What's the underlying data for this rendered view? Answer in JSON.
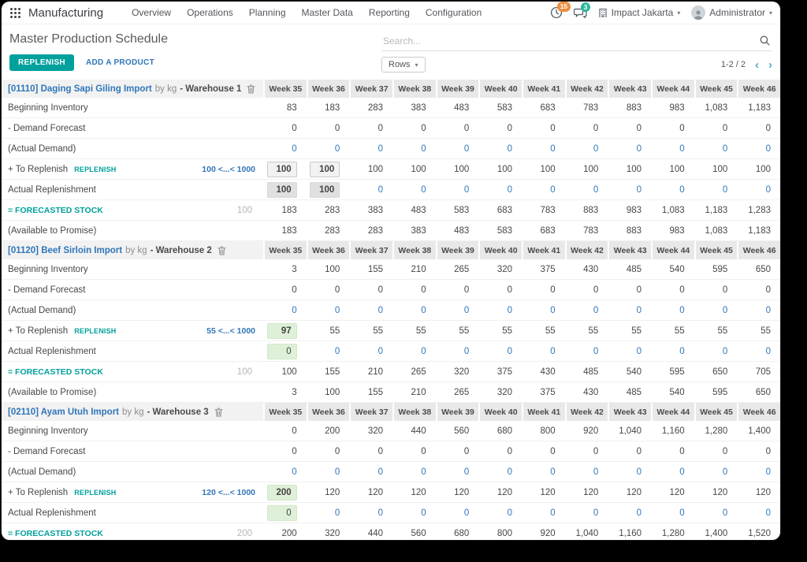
{
  "colors": {
    "accent": "#00a09d",
    "link": "#3076b9",
    "badge_activity": "#ee8e3f",
    "badge_message": "#2fb79e"
  },
  "navbar": {
    "app_name": "Manufacturing",
    "menus": [
      "Overview",
      "Operations",
      "Planning",
      "Master Data",
      "Reporting",
      "Configuration"
    ],
    "activity_badge": "15",
    "message_badge": "3",
    "company": "Impact Jakarta",
    "user": "Administrator"
  },
  "control_panel": {
    "title": "Master Production Schedule",
    "replenish_button": "REPLENISH",
    "add_product_link": "ADD A PRODUCT",
    "search_placeholder": "Search...",
    "rows_button": "Rows",
    "pager": "1-2 / 2"
  },
  "weeks": [
    "Week 35",
    "Week 36",
    "Week 37",
    "Week 38",
    "Week 39",
    "Week 40",
    "Week 41",
    "Week 42",
    "Week 43",
    "Week 44",
    "Week 45",
    "Week 46"
  ],
  "products": [
    {
      "title": "[01110] Daging Sapi Giling Import",
      "unit": "by kg",
      "warehouse": "- Warehouse 1",
      "rows": [
        {
          "key": "beginning",
          "label": "Beginning Inventory",
          "default": "num",
          "values": [
            "83",
            "183",
            "283",
            "383",
            "483",
            "583",
            "683",
            "783",
            "883",
            "983",
            "1,083",
            "1,183"
          ]
        },
        {
          "key": "demand_forecast",
          "label": "- Demand Forecast",
          "default": "num",
          "values": [
            "0",
            "0",
            "0",
            "0",
            "0",
            "0",
            "0",
            "0",
            "0",
            "0",
            "0",
            "0"
          ]
        },
        {
          "key": "actual_demand",
          "label": "(Actual Demand)",
          "default": "link",
          "values": [
            "0",
            "0",
            "0",
            "0",
            "0",
            "0",
            "0",
            "0",
            "0",
            "0",
            "0",
            "0"
          ]
        },
        {
          "key": "to_replenish",
          "label": "+ To Replenish",
          "link": "REPLENISH",
          "range": "100 <...< 1000",
          "default": "num",
          "special": {
            "0": "gray-input",
            "1": "gray-input"
          },
          "values": [
            "100",
            "100",
            "100",
            "100",
            "100",
            "100",
            "100",
            "100",
            "100",
            "100",
            "100",
            "100"
          ]
        },
        {
          "key": "actual_replenishment",
          "label": "Actual Replenishment",
          "default": "link",
          "special": {
            "0": "gray-fill",
            "1": "gray-fill"
          },
          "values": [
            "100",
            "100",
            "0",
            "0",
            "0",
            "0",
            "0",
            "0",
            "0",
            "0",
            "0",
            "0"
          ]
        },
        {
          "key": "forecasted",
          "label": "= FORECASTED STOCK",
          "indicator": "100",
          "default": "num",
          "values": [
            "183",
            "283",
            "383",
            "483",
            "583",
            "683",
            "783",
            "883",
            "983",
            "1,083",
            "1,183",
            "1,283"
          ]
        },
        {
          "key": "atp",
          "label": "(Available to Promise)",
          "default": "num",
          "values": [
            "183",
            "283",
            "283",
            "383",
            "483",
            "583",
            "683",
            "783",
            "883",
            "983",
            "1,083",
            "1,183"
          ]
        }
      ]
    },
    {
      "title": "[01120] Beef Sirloin Import",
      "unit": "by kg",
      "warehouse": "- Warehouse 2",
      "rows": [
        {
          "key": "beginning",
          "label": "Beginning Inventory",
          "default": "num",
          "values": [
            "3",
            "100",
            "155",
            "210",
            "265",
            "320",
            "375",
            "430",
            "485",
            "540",
            "595",
            "650"
          ]
        },
        {
          "key": "demand_forecast",
          "label": "- Demand Forecast",
          "default": "num",
          "values": [
            "0",
            "0",
            "0",
            "0",
            "0",
            "0",
            "0",
            "0",
            "0",
            "0",
            "0",
            "0"
          ]
        },
        {
          "key": "actual_demand",
          "label": "(Actual Demand)",
          "default": "link",
          "values": [
            "0",
            "0",
            "0",
            "0",
            "0",
            "0",
            "0",
            "0",
            "0",
            "0",
            "0",
            "0"
          ]
        },
        {
          "key": "to_replenish",
          "label": "+ To Replenish",
          "link": "REPLENISH",
          "range": "55 <...< 1000",
          "default": "num",
          "special": {
            "0": "green-input"
          },
          "values": [
            "97",
            "55",
            "55",
            "55",
            "55",
            "55",
            "55",
            "55",
            "55",
            "55",
            "55",
            "55"
          ]
        },
        {
          "key": "actual_replenishment",
          "label": "Actual Replenishment",
          "default": "link",
          "special": {
            "0": "green-fill"
          },
          "values": [
            "0",
            "0",
            "0",
            "0",
            "0",
            "0",
            "0",
            "0",
            "0",
            "0",
            "0",
            "0"
          ]
        },
        {
          "key": "forecasted",
          "label": "= FORECASTED STOCK",
          "indicator": "100",
          "default": "num",
          "values": [
            "100",
            "155",
            "210",
            "265",
            "320",
            "375",
            "430",
            "485",
            "540",
            "595",
            "650",
            "705"
          ]
        },
        {
          "key": "atp",
          "label": "(Available to Promise)",
          "default": "num",
          "values": [
            "3",
            "100",
            "155",
            "210",
            "265",
            "320",
            "375",
            "430",
            "485",
            "540",
            "595",
            "650"
          ]
        }
      ]
    },
    {
      "title": "[02110] Ayam Utuh Import",
      "unit": "by kg",
      "warehouse": "- Warehouse 3",
      "rows": [
        {
          "key": "beginning",
          "label": "Beginning Inventory",
          "default": "num",
          "values": [
            "0",
            "200",
            "320",
            "440",
            "560",
            "680",
            "800",
            "920",
            "1,040",
            "1,160",
            "1,280",
            "1,400"
          ]
        },
        {
          "key": "demand_forecast",
          "label": "- Demand Forecast",
          "default": "num",
          "values": [
            "0",
            "0",
            "0",
            "0",
            "0",
            "0",
            "0",
            "0",
            "0",
            "0",
            "0",
            "0"
          ]
        },
        {
          "key": "actual_demand",
          "label": "(Actual Demand)",
          "default": "link",
          "values": [
            "0",
            "0",
            "0",
            "0",
            "0",
            "0",
            "0",
            "0",
            "0",
            "0",
            "0",
            "0"
          ]
        },
        {
          "key": "to_replenish",
          "label": "+ To Replenish",
          "link": "REPLENISH",
          "range": "120 <...< 1000",
          "default": "num",
          "special": {
            "0": "green-input"
          },
          "values": [
            "200",
            "120",
            "120",
            "120",
            "120",
            "120",
            "120",
            "120",
            "120",
            "120",
            "120",
            "120"
          ]
        },
        {
          "key": "actual_replenishment",
          "label": "Actual Replenishment",
          "default": "link",
          "special": {
            "0": "green-fill"
          },
          "values": [
            "0",
            "0",
            "0",
            "0",
            "0",
            "0",
            "0",
            "0",
            "0",
            "0",
            "0",
            "0"
          ]
        },
        {
          "key": "forecasted",
          "label": "= FORECASTED STOCK",
          "indicator": "200",
          "default": "num",
          "values": [
            "200",
            "320",
            "440",
            "560",
            "680",
            "800",
            "920",
            "1,040",
            "1,160",
            "1,280",
            "1,400",
            "1,520"
          ]
        }
      ]
    }
  ]
}
